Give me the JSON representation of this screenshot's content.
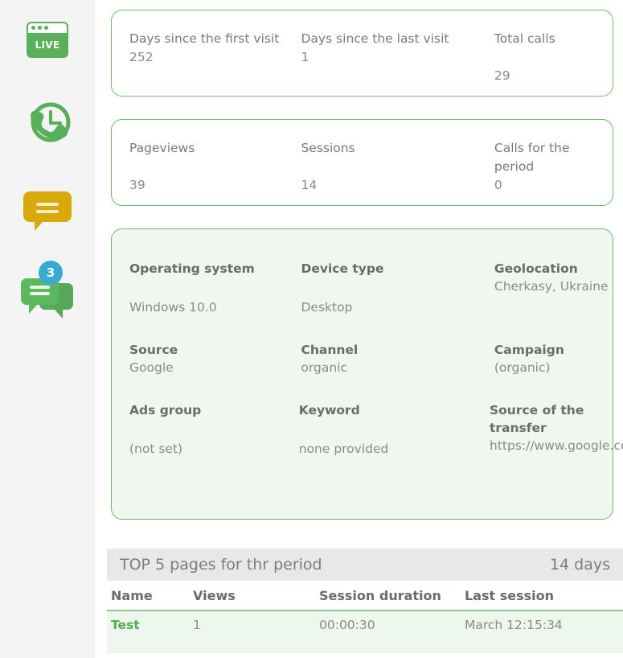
{
  "sidebar": {
    "items": [
      {
        "name": "live-monitor",
        "icon": "live-window-icon",
        "label": "LIVE"
      },
      {
        "name": "call-history",
        "icon": "phone-clock-icon",
        "label": ""
      },
      {
        "name": "messages",
        "icon": "speech-bubble-icon",
        "label": ""
      },
      {
        "name": "chats",
        "icon": "double-speech-bubble-icon",
        "label": "",
        "badge": "3"
      }
    ],
    "colors": {
      "green": "#58b15a",
      "yellow": "#d9a90c",
      "badge_blue": "#3aa9d4",
      "background": "#f4f4f4"
    }
  },
  "cards": {
    "visits": {
      "items": [
        {
          "label": "Days since the first visit",
          "value": "252"
        },
        {
          "label": "Days since the last visit",
          "value": "1"
        },
        {
          "label": "Total calls",
          "value": "29"
        }
      ]
    },
    "traffic": {
      "items": [
        {
          "label": "Pageviews",
          "value": "39"
        },
        {
          "label": "Sessions",
          "value": "14"
        },
        {
          "label": "Calls for the period",
          "value": "0"
        }
      ]
    },
    "info": {
      "rows": [
        [
          {
            "label": "Operating system",
            "value": "Windows 10.0"
          },
          {
            "label": "Device type",
            "value": "Desktop"
          },
          {
            "label": "Geolocation",
            "value": "Cherkasy, Ukraine"
          }
        ],
        [
          {
            "label": "Source",
            "value": "Google"
          },
          {
            "label": "Channel",
            "value": "organic"
          },
          {
            "label": "Campaign",
            "value": "(organic)"
          }
        ],
        [
          {
            "label": "Ads group",
            "value": "(not set)"
          },
          {
            "label": "Keyword",
            "value": "none provided"
          },
          {
            "label": "Source of the transfer",
            "value": "https://www.google.com/"
          }
        ]
      ]
    }
  },
  "table": {
    "title": "TOP 5 pages for thr period",
    "period": "14 days",
    "headers": [
      "Name",
      "Views",
      "Session duration",
      "Last session"
    ],
    "rows": [
      {
        "name": "Test",
        "views": "1",
        "duration": "00:00:30",
        "last_session": "March 12:15:34"
      }
    ]
  }
}
